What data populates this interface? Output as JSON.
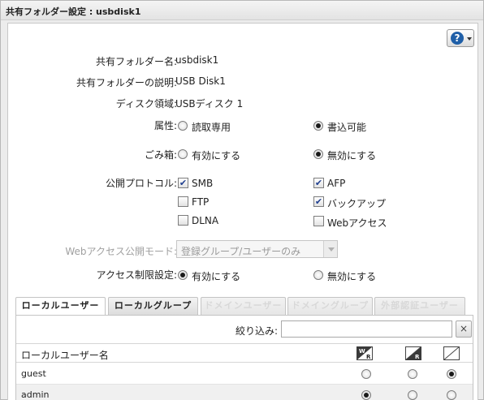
{
  "window": {
    "title": "共有フォルダー設定 : usbdisk1"
  },
  "help": {
    "label": "?"
  },
  "form": {
    "name": {
      "label": "共有フォルダー名:",
      "value": "usbdisk1"
    },
    "description": {
      "label": "共有フォルダーの説明:",
      "value": "USB Disk1"
    },
    "volume": {
      "label": "ディスク領域:",
      "value": "USBディスク 1"
    },
    "attribute": {
      "label": "属性:",
      "options": [
        {
          "label": "読取専用",
          "selected": false
        },
        {
          "label": "書込可能",
          "selected": true
        }
      ]
    },
    "trash": {
      "label": "ごみ箱:",
      "options": [
        {
          "label": "有効にする",
          "selected": false
        },
        {
          "label": "無効にする",
          "selected": true
        }
      ]
    },
    "protocols": {
      "label": "公開プロトコル:",
      "items": [
        {
          "label": "SMB",
          "checked": true
        },
        {
          "label": "AFP",
          "checked": true
        },
        {
          "label": "FTP",
          "checked": false
        },
        {
          "label": "バックアップ",
          "checked": true
        },
        {
          "label": "DLNA",
          "checked": false
        },
        {
          "label": "Webアクセス",
          "checked": false
        }
      ]
    },
    "web_mode": {
      "label": "Webアクセス公開モード:",
      "value": "登録グループ/ユーザーのみ"
    },
    "access_restriction": {
      "label": "アクセス制限設定:",
      "options": [
        {
          "label": "有効にする",
          "selected": true
        },
        {
          "label": "無効にする",
          "selected": false
        }
      ]
    }
  },
  "tabs": [
    {
      "label": "ローカルユーザー",
      "state": "active"
    },
    {
      "label": "ローカルグループ",
      "state": "normal"
    },
    {
      "label": "ドメインユーザー",
      "state": "disabled"
    },
    {
      "label": "ドメイングループ",
      "state": "disabled"
    },
    {
      "label": "外部認証ユーザー",
      "state": "disabled"
    }
  ],
  "filter": {
    "label": "絞り込み:",
    "value": "",
    "clear": "×"
  },
  "table": {
    "column": "ローカルユーザー名",
    "perm_icons": [
      "read-write-icon",
      "read-only-icon",
      "no-access-icon"
    ],
    "rows": [
      {
        "name": "guest",
        "perm": 2
      },
      {
        "name": "admin",
        "perm": 0
      }
    ]
  },
  "colors": {
    "title_bg": "#e3e3e3",
    "panel_bg": "#ffffff",
    "help_icon": "#1f5fa8",
    "check_mark": "#1f3f8f"
  }
}
